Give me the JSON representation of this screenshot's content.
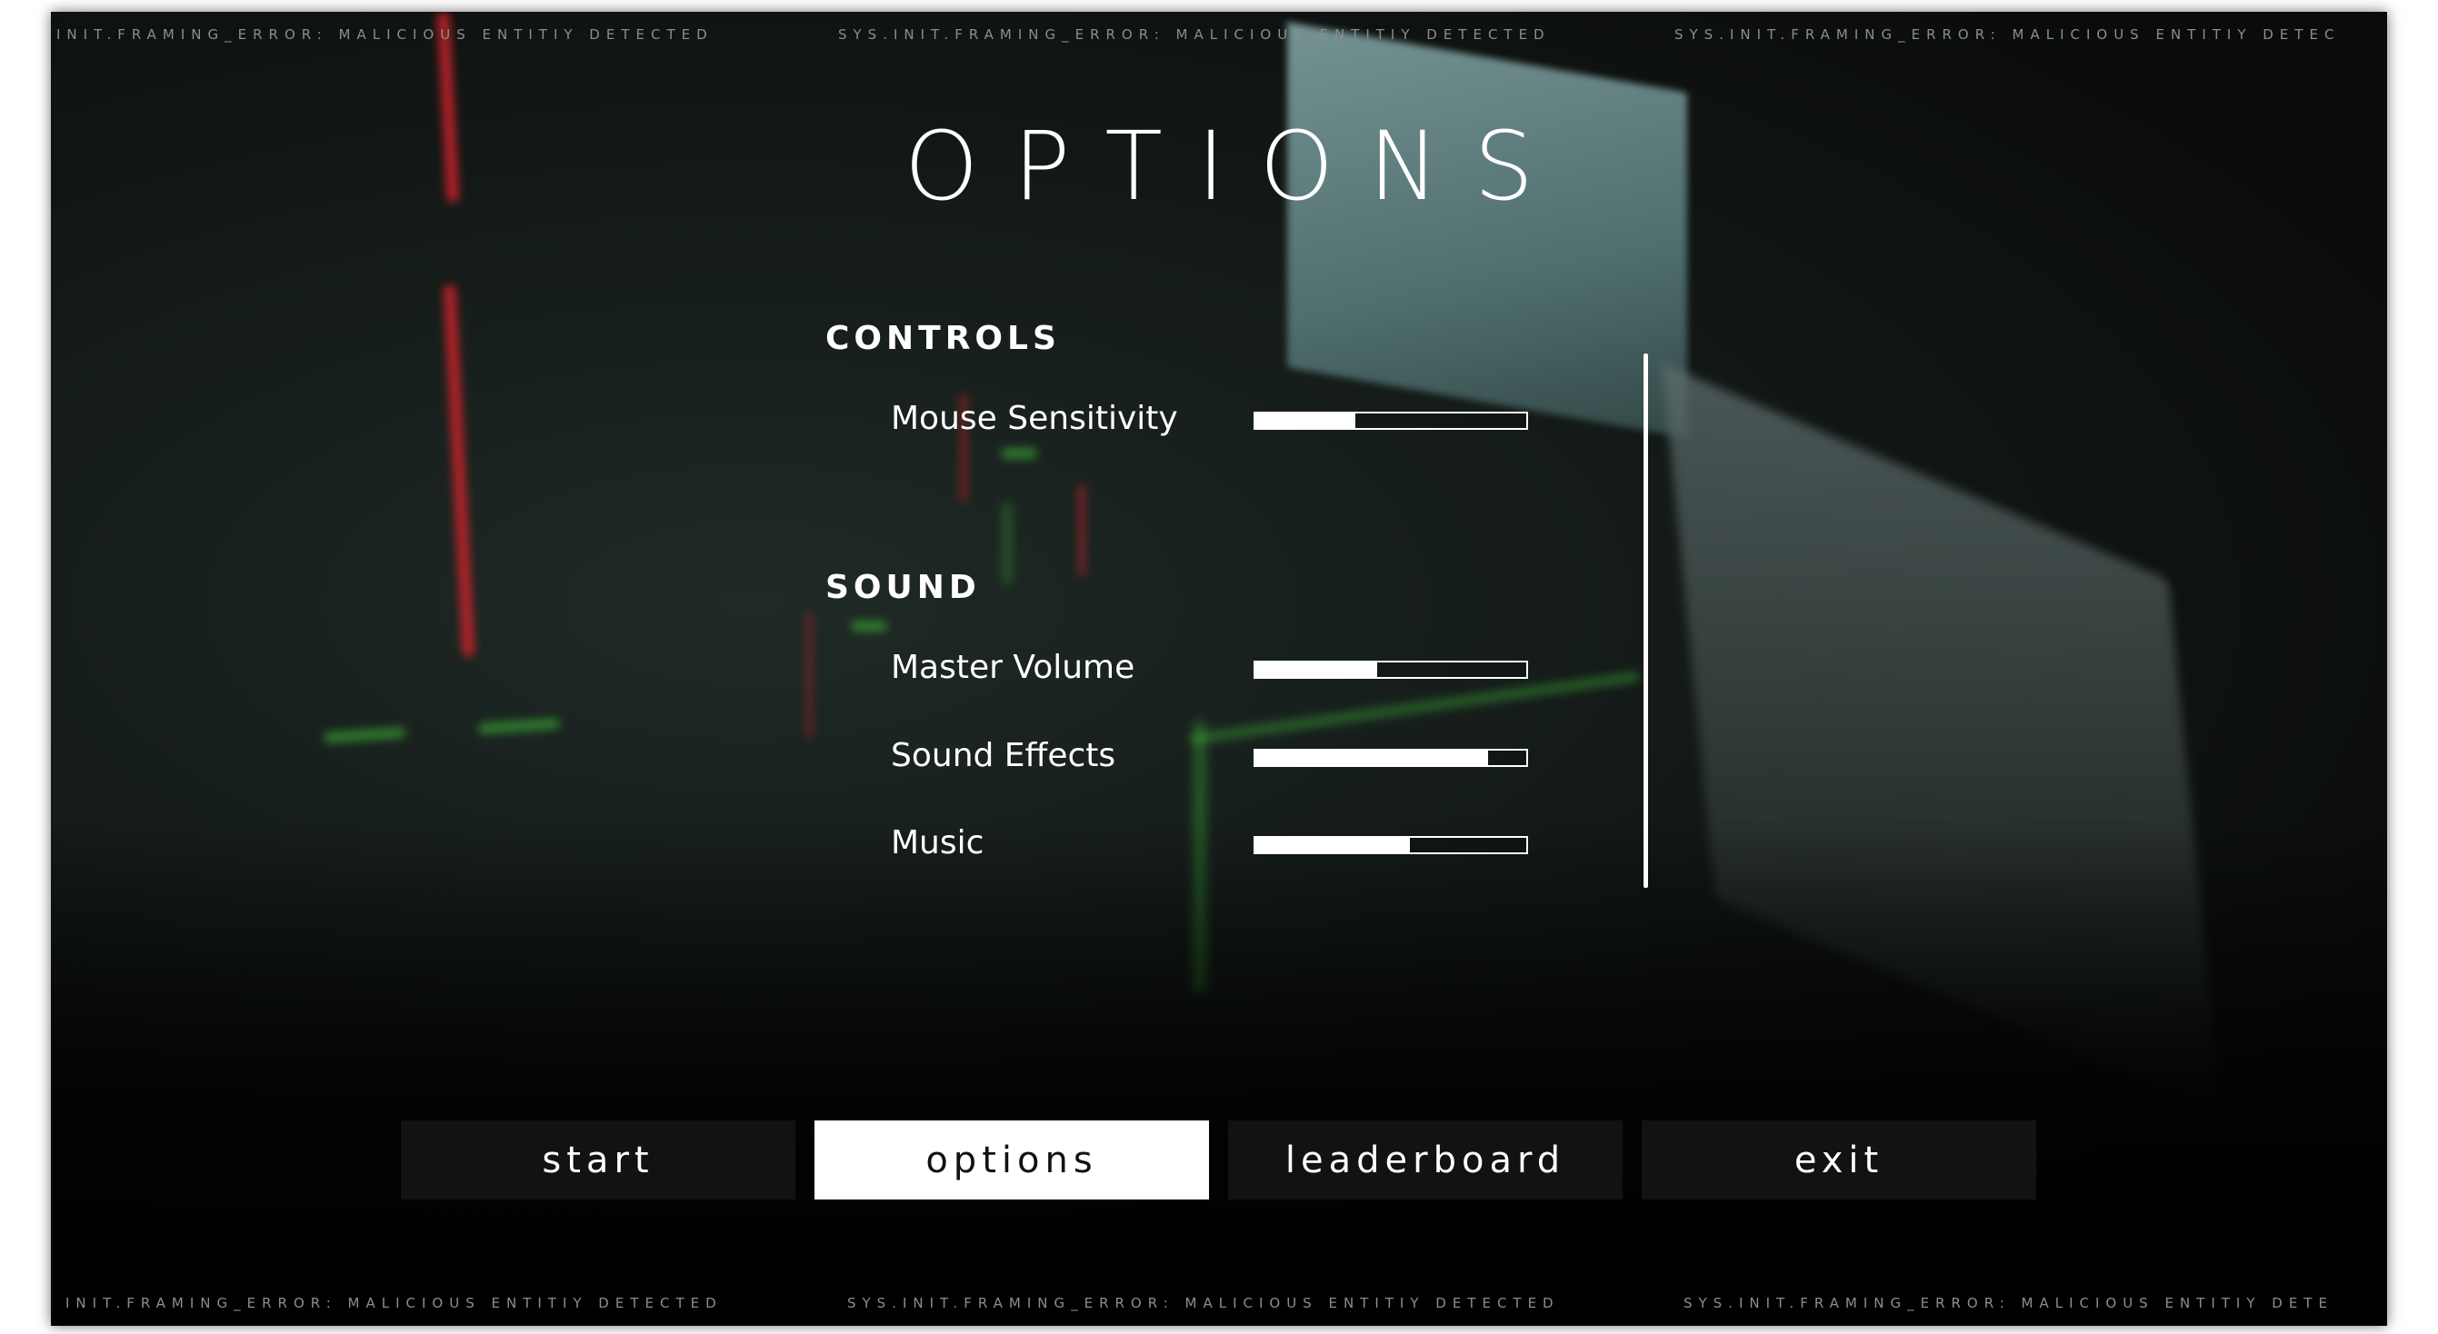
{
  "ticker": {
    "text": "SYS.INIT.FRAMING_ERROR: MALICIOUS ENTITIY DETECTED",
    "top_text_1": "INIT.FRAMING_ERROR: MALICIOUS ENTITIY DETECTED",
    "top_text_2": "SYS.INIT.FRAMING_ERROR: MALICIOUS ENTITIY DETECTED",
    "top_text_3": "SYS.INIT.FRAMING_ERROR: MALICIOUS ENTITIY DETEC",
    "bottom_text_1": "INIT.FRAMING_ERROR: MALICIOUS ENTITIY DETECTED",
    "bottom_text_2": "SYS.INIT.FRAMING_ERROR: MALICIOUS ENTITIY DETECTED",
    "bottom_text_3": "SYS.INIT.FRAMING_ERROR: MALICIOUS ENTITIY DETE"
  },
  "title": "OPTIONS",
  "sections": {
    "controls": {
      "title": "CONTROLS",
      "mouse_sensitivity": {
        "label": "Mouse Sensitivity",
        "value": 0.37
      }
    },
    "sound": {
      "title": "SOUND",
      "master_volume": {
        "label": "Master Volume",
        "value": 0.45
      },
      "sound_effects": {
        "label": "Sound Effects",
        "value": 0.86
      },
      "music": {
        "label": "Music",
        "value": 0.57
      }
    }
  },
  "menu": {
    "start": "start",
    "options": "options",
    "leaderboard": "leaderboard",
    "exit": "exit",
    "active": "options"
  },
  "colors": {
    "text": "#ffffff",
    "accent_red": "#c8232a",
    "accent_green": "#3fb338",
    "button_bg": "#111212",
    "active_button_bg": "#ffffff"
  }
}
